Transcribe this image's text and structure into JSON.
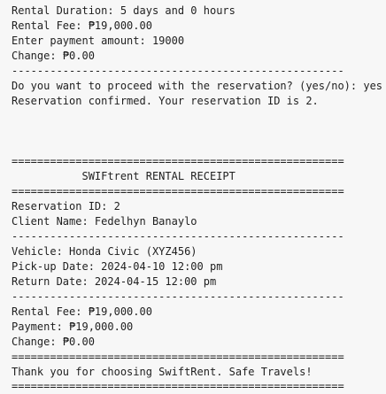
{
  "terminal": {
    "lines": [
      "Rental Duration: 5 days and 0 hours",
      "Rental Fee: ₱19,000.00",
      "Enter payment amount: 19000",
      "Change: ₱0.00",
      "----------------------------------------------------",
      "Do you want to proceed with the reservation? (yes/no): yes",
      "Reservation confirmed. Your reservation ID is 2.",
      "====================================================",
      "           SWIFtrent RENTAL RECEIPT",
      "====================================================",
      "Reservation ID: 2",
      "Client Name: Fedelhyn Banaylo",
      "----------------------------------------------------",
      "Vehicle: Honda Civic (XYZ456)",
      "Pick-up Date: 2024-04-10 12:00 pm",
      "Return Date: 2024-04-15 12:00 pm",
      "----------------------------------------------------",
      "Rental Fee: ₱19,000.00",
      "Payment: ₱19,000.00",
      "Change: ₱0.00",
      "====================================================",
      "Thank you for choosing SwiftRent. Safe Travels!",
      "===================================================="
    ]
  }
}
